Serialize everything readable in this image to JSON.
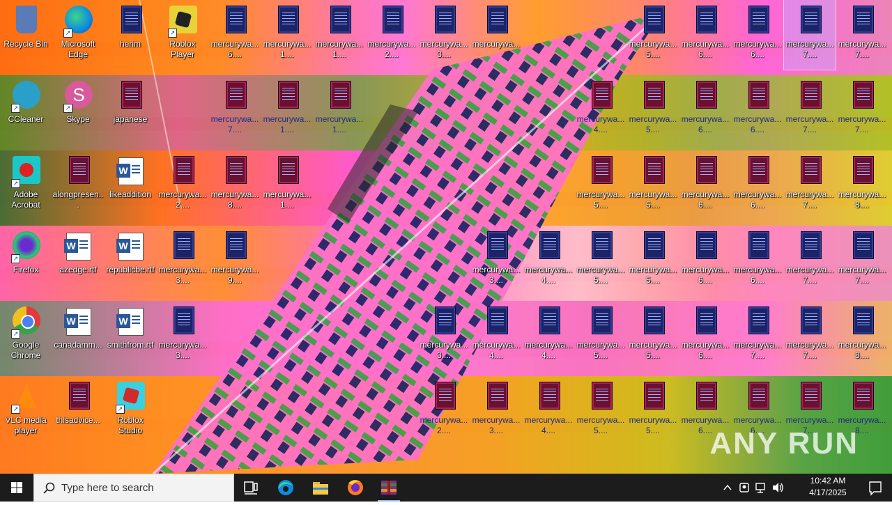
{
  "desktop": {
    "icons": [
      {
        "id": "recycle-bin",
        "label": "Recycle Bin",
        "type": "app",
        "col": 0,
        "row": 0
      },
      {
        "id": "edge",
        "label": "Microsoft Edge",
        "type": "app",
        "col": 1,
        "row": 0
      },
      {
        "id": "herim",
        "label": "herim",
        "type": "doc",
        "col": 2,
        "row": 0
      },
      {
        "id": "roblox-player",
        "label": "Roblox Player",
        "type": "app",
        "col": 3,
        "row": 0
      },
      {
        "id": "m-0-4",
        "label": "mercurywa... 6....",
        "type": "doc",
        "col": 4,
        "row": 0
      },
      {
        "id": "m-0-5",
        "label": "mercurywa... 1....",
        "type": "doc",
        "col": 5,
        "row": 0
      },
      {
        "id": "m-0-6",
        "label": "mercurywa... 1....",
        "type": "doc",
        "col": 6,
        "row": 0
      },
      {
        "id": "m-0-7",
        "label": "mercurywa... 2....",
        "type": "doc",
        "col": 7,
        "row": 0
      },
      {
        "id": "m-0-8",
        "label": "mercurywa... 3....",
        "type": "doc",
        "col": 8,
        "row": 0
      },
      {
        "id": "m-0-9",
        "label": "mercurywa...",
        "type": "doc",
        "col": 9,
        "row": 0
      },
      {
        "id": "m-0-12",
        "label": "mercurywa... 5....",
        "type": "doc",
        "col": 12,
        "row": 0
      },
      {
        "id": "m-0-13",
        "label": "mercurywa... 6....",
        "type": "doc",
        "col": 13,
        "row": 0
      },
      {
        "id": "m-0-14",
        "label": "mercurywa... 6....",
        "type": "doc",
        "col": 14,
        "row": 0
      },
      {
        "id": "m-0-15",
        "label": "mercurywa... 7....",
        "type": "doc",
        "col": 15,
        "row": 0,
        "selected": true
      },
      {
        "id": "m-0-16",
        "label": "mercurywa... 7....",
        "type": "doc",
        "col": 16,
        "row": 0
      },
      {
        "id": "ccleaner",
        "label": "CCleaner",
        "type": "app",
        "col": 0,
        "row": 1
      },
      {
        "id": "skype",
        "label": "Skype",
        "type": "app",
        "col": 1,
        "row": 1
      },
      {
        "id": "japanese",
        "label": "japanese",
        "type": "doc",
        "col": 2,
        "row": 1
      },
      {
        "id": "m-1-4",
        "label": "mercurywa... 7....",
        "type": "doc",
        "col": 4,
        "row": 1
      },
      {
        "id": "m-1-5",
        "label": "mercurywa... 1....",
        "type": "doc",
        "col": 5,
        "row": 1
      },
      {
        "id": "m-1-6",
        "label": "mercurywa... 1....",
        "type": "doc",
        "col": 6,
        "row": 1
      },
      {
        "id": "m-1-11",
        "label": "mercurywa... 4....",
        "type": "doc",
        "col": 11,
        "row": 1
      },
      {
        "id": "m-1-12",
        "label": "mercurywa... 5....",
        "type": "doc",
        "col": 12,
        "row": 1
      },
      {
        "id": "m-1-13",
        "label": "mercurywa... 6....",
        "type": "doc",
        "col": 13,
        "row": 1
      },
      {
        "id": "m-1-14",
        "label": "mercurywa... 6....",
        "type": "doc",
        "col": 14,
        "row": 1
      },
      {
        "id": "m-1-15",
        "label": "mercurywa... 7....",
        "type": "doc",
        "col": 15,
        "row": 1
      },
      {
        "id": "m-1-16",
        "label": "mercurywa... 7....",
        "type": "doc",
        "col": 16,
        "row": 1
      },
      {
        "id": "acrobat",
        "label": "Adobe Acrobat",
        "type": "app",
        "col": 0,
        "row": 2
      },
      {
        "id": "along",
        "label": "alongpresen...",
        "type": "doc",
        "col": 1,
        "row": 2
      },
      {
        "id": "likeaddition",
        "label": "likeaddition",
        "type": "word",
        "col": 2,
        "row": 2
      },
      {
        "id": "m-2-3",
        "label": "mercurywa... 2....",
        "type": "doc",
        "col": 3,
        "row": 2
      },
      {
        "id": "m-2-4",
        "label": "mercurywa... 8....",
        "type": "doc",
        "col": 4,
        "row": 2
      },
      {
        "id": "m-2-5",
        "label": "mercurywa... 1....",
        "type": "doc",
        "col": 5,
        "row": 2
      },
      {
        "id": "m-2-11",
        "label": "mercurywa... 5....",
        "type": "doc",
        "col": 11,
        "row": 2
      },
      {
        "id": "m-2-12",
        "label": "mercurywa... 5....",
        "type": "doc",
        "col": 12,
        "row": 2
      },
      {
        "id": "m-2-13",
        "label": "mercurywa... 6....",
        "type": "doc",
        "col": 13,
        "row": 2
      },
      {
        "id": "m-2-14",
        "label": "mercurywa... 6....",
        "type": "doc",
        "col": 14,
        "row": 2
      },
      {
        "id": "m-2-15",
        "label": "mercurywa... 7....",
        "type": "doc",
        "col": 15,
        "row": 2
      },
      {
        "id": "m-2-16",
        "label": "mercurywa... 8....",
        "type": "doc",
        "col": 16,
        "row": 2
      },
      {
        "id": "firefox",
        "label": "Firefox",
        "type": "app",
        "col": 0,
        "row": 3
      },
      {
        "id": "azedge",
        "label": "azedge.rtf",
        "type": "word",
        "col": 1,
        "row": 3
      },
      {
        "id": "republicbe",
        "label": "republicbe.rtf",
        "type": "word",
        "col": 2,
        "row": 3
      },
      {
        "id": "m-3-3",
        "label": "mercurywa... 3....",
        "type": "doc",
        "col": 3,
        "row": 3
      },
      {
        "id": "m-3-4",
        "label": "mercurywa... 9....",
        "type": "doc",
        "col": 4,
        "row": 3
      },
      {
        "id": "m-3-9",
        "label": "mercurywa... 3....",
        "type": "doc",
        "col": 9,
        "row": 3
      },
      {
        "id": "m-3-10",
        "label": "mercurywa... 4....",
        "type": "doc",
        "col": 10,
        "row": 3
      },
      {
        "id": "m-3-11",
        "label": "mercurywa... 5....",
        "type": "doc",
        "col": 11,
        "row": 3
      },
      {
        "id": "m-3-12",
        "label": "mercurywa... 5....",
        "type": "doc",
        "col": 12,
        "row": 3
      },
      {
        "id": "m-3-13",
        "label": "mercurywa... 6....",
        "type": "doc",
        "col": 13,
        "row": 3
      },
      {
        "id": "m-3-14",
        "label": "mercurywa... 6....",
        "type": "doc",
        "col": 14,
        "row": 3
      },
      {
        "id": "m-3-15",
        "label": "mercurywa... 7....",
        "type": "doc",
        "col": 15,
        "row": 3
      },
      {
        "id": "m-3-16",
        "label": "mercurywa... 7....",
        "type": "doc",
        "col": 16,
        "row": 3
      },
      {
        "id": "chrome",
        "label": "Google Chrome",
        "type": "app",
        "col": 0,
        "row": 4
      },
      {
        "id": "canadamm",
        "label": "canadamm...",
        "type": "word",
        "col": 1,
        "row": 4
      },
      {
        "id": "smithfrom",
        "label": "smithfrom.rtf",
        "type": "word",
        "col": 2,
        "row": 4
      },
      {
        "id": "m-4-3",
        "label": "mercurywa... 3....",
        "type": "doc",
        "col": 3,
        "row": 4
      },
      {
        "id": "m-4-8",
        "label": "mercurywa... 3....",
        "type": "doc",
        "col": 8,
        "row": 4
      },
      {
        "id": "m-4-9",
        "label": "mercurywa... 4....",
        "type": "doc",
        "col": 9,
        "row": 4
      },
      {
        "id": "m-4-10",
        "label": "mercurywa... 4....",
        "type": "doc",
        "col": 10,
        "row": 4
      },
      {
        "id": "m-4-11",
        "label": "mercurywa... 5....",
        "type": "doc",
        "col": 11,
        "row": 4
      },
      {
        "id": "m-4-12",
        "label": "mercurywa... 5....",
        "type": "doc",
        "col": 12,
        "row": 4
      },
      {
        "id": "m-4-13",
        "label": "mercurywa... 6....",
        "type": "doc",
        "col": 13,
        "row": 4
      },
      {
        "id": "m-4-14",
        "label": "mercurywa... 7....",
        "type": "doc",
        "col": 14,
        "row": 4
      },
      {
        "id": "m-4-15",
        "label": "mercurywa... 7....",
        "type": "doc",
        "col": 15,
        "row": 4
      },
      {
        "id": "m-4-16",
        "label": "mercurywa... 8....",
        "type": "doc",
        "col": 16,
        "row": 4
      },
      {
        "id": "vlc",
        "label": "VLC media player",
        "type": "app",
        "col": 0,
        "row": 5
      },
      {
        "id": "thisadvice",
        "label": "thisadvice...",
        "type": "doc",
        "col": 1,
        "row": 5
      },
      {
        "id": "roblox-studio",
        "label": "Roblox Studio",
        "type": "app",
        "col": 2,
        "row": 5
      },
      {
        "id": "m-5-8",
        "label": "mercurywa... 2....",
        "type": "doc",
        "col": 8,
        "row": 5
      },
      {
        "id": "m-5-9",
        "label": "mercurywa... 3....",
        "type": "doc",
        "col": 9,
        "row": 5
      },
      {
        "id": "m-5-10",
        "label": "mercurywa... 4....",
        "type": "doc",
        "col": 10,
        "row": 5
      },
      {
        "id": "m-5-11",
        "label": "mercurywa... 5....",
        "type": "doc",
        "col": 11,
        "row": 5
      },
      {
        "id": "m-5-12",
        "label": "mercurywa... 5....",
        "type": "doc",
        "col": 12,
        "row": 5
      },
      {
        "id": "m-5-13",
        "label": "mercurywa... 6....",
        "type": "doc",
        "col": 13,
        "row": 5
      },
      {
        "id": "m-5-14",
        "label": "mercurywa... 6....",
        "type": "doc",
        "col": 14,
        "row": 5
      },
      {
        "id": "m-5-15",
        "label": "mercurywa... 7....",
        "type": "doc",
        "col": 15,
        "row": 5
      },
      {
        "id": "m-5-16",
        "label": "mercurywa... 8....",
        "type": "doc",
        "col": 16,
        "row": 5
      }
    ],
    "watermark": "ANY RUN"
  },
  "taskbar": {
    "search_placeholder": "Type here to search",
    "pinned": [
      {
        "id": "task-view",
        "icon": "task-view-icon"
      },
      {
        "id": "edge",
        "icon": "edge-icon"
      },
      {
        "id": "file-explorer",
        "icon": "folder-icon"
      },
      {
        "id": "firefox",
        "icon": "firefox-icon"
      },
      {
        "id": "winrar",
        "icon": "winrar-icon",
        "active": true
      }
    ],
    "clock": {
      "time": "10:42 AM",
      "date": "4/17/2025"
    }
  },
  "colors": {
    "taskbar": "#1c1c1c",
    "accent": "#9ab9ff"
  }
}
